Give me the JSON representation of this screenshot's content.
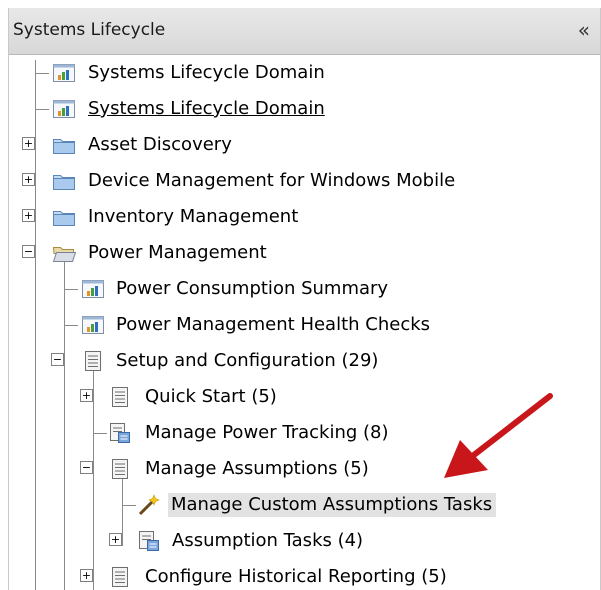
{
  "panel": {
    "title": "Systems Lifecycle",
    "collapse_glyph": "«"
  },
  "tree": {
    "items": [
      {
        "label": "Systems Lifecycle Domain",
        "icon": "chart-report-icon"
      },
      {
        "label": "Systems Lifecycle Domain",
        "icon": "chart-report-icon",
        "underlined": true
      },
      {
        "label": "Asset Discovery",
        "icon": "folder-icon",
        "expanded": false
      },
      {
        "label": "Device Management for Windows Mobile",
        "icon": "folder-icon",
        "expanded": false
      },
      {
        "label": "Inventory Management",
        "icon": "folder-icon",
        "expanded": false
      },
      {
        "label": "Power Management",
        "icon": "folder-open-icon",
        "expanded": true
      },
      {
        "label": "Power Consumption Summary",
        "icon": "chart-report-icon"
      },
      {
        "label": "Power Management Health Checks",
        "icon": "chart-report-icon"
      },
      {
        "label": "Setup and Configuration (29)",
        "icon": "list-icon",
        "expanded": true
      },
      {
        "label": "Quick Start (5)",
        "icon": "list-icon",
        "expanded": false
      },
      {
        "label": "Manage Power Tracking (8)",
        "icon": "task-list-icon"
      },
      {
        "label": "Manage Assumptions (5)",
        "icon": "list-icon",
        "expanded": true
      },
      {
        "label": "Manage Custom Assumptions Tasks",
        "icon": "wand-icon",
        "selected": true
      },
      {
        "label": "Assumption Tasks (4)",
        "icon": "task-list-icon",
        "expanded": false
      },
      {
        "label": "Configure Historical Reporting (5)",
        "icon": "list-icon",
        "expanded": false
      }
    ]
  },
  "expander_symbols": {
    "collapsed": "+",
    "expanded": "−"
  },
  "colors": {
    "arrow": "#c8161b",
    "selection": "#e2e2e2",
    "header": "#dcdcdc"
  }
}
